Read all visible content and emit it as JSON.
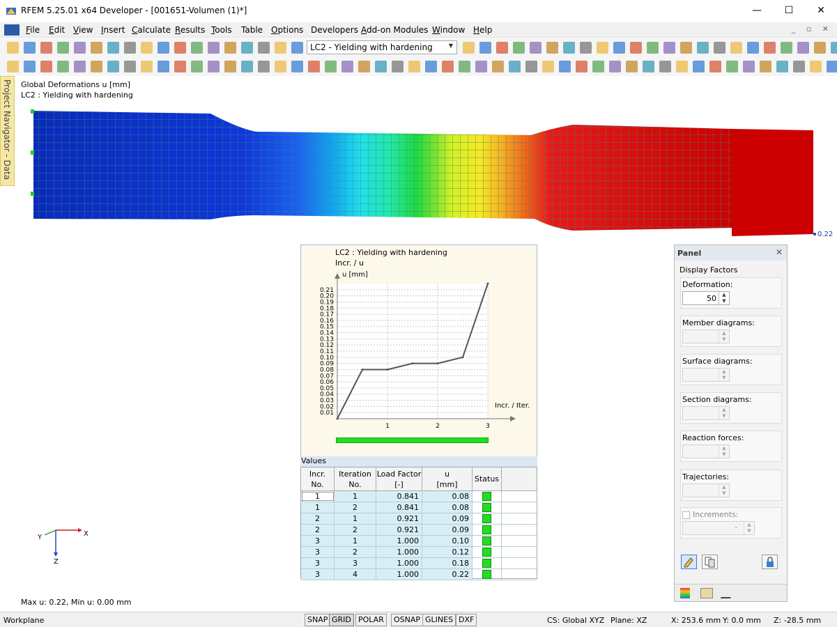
{
  "window": {
    "title": "RFEM 5.25.01 x64 Developer - [001651-Volumen (1)*]",
    "minimize": "—",
    "maximize": "☐",
    "close": "✕"
  },
  "menu": [
    {
      "label": "File",
      "u": "F",
      "rest": "ile"
    },
    {
      "label": "Edit",
      "u": "E",
      "rest": "dit"
    },
    {
      "label": "View",
      "u": "V",
      "rest": "iew"
    },
    {
      "label": "Insert",
      "u": "I",
      "rest": "nsert"
    },
    {
      "label": "Calculate",
      "u": "C",
      "rest": "alculate"
    },
    {
      "label": "Results",
      "u": "R",
      "rest": "esults"
    },
    {
      "label": "Tools",
      "u": "T",
      "rest": "ools"
    },
    {
      "label": "Table",
      "u": "",
      "rest": "Table"
    },
    {
      "label": "Options",
      "u": "O",
      "rest": "ptions"
    },
    {
      "label": "Developers",
      "u": "",
      "rest": "Developers"
    },
    {
      "label": "Add-on Modules",
      "u": "A",
      "rest": "dd-on Modules"
    },
    {
      "label": "Window",
      "u": "W",
      "rest": "indow"
    },
    {
      "label": "Help",
      "u": "H",
      "rest": "elp"
    }
  ],
  "toolbar": {
    "load_case": "LC2 - Yielding with hardening"
  },
  "sidetab": "Project Navigator - Data",
  "viewport": {
    "result_type": "Global Deformations u [mm]",
    "load_case": "LC2 : Yielding with hardening",
    "max_label": "0.22",
    "maxmin": "Max u: 0.22, Min u: 0.00 mm",
    "axis_x": "X",
    "axis_y": "Y",
    "axis_z": "Z"
  },
  "chart": {
    "title": "LC2 : Yielding with hardening",
    "subtitle": "Incr. / u",
    "ylabel": "u [mm]",
    "xlabel": "Incr. / Iter."
  },
  "chart_data": {
    "type": "line",
    "title": "LC2 : Yielding with hardening",
    "xlabel": "Incr. / Iter.",
    "ylabel": "u [mm]",
    "x_ticks": [
      "1",
      "2",
      "3"
    ],
    "y_ticks": [
      "0.01",
      "0.02",
      "0.03",
      "0.04",
      "0.05",
      "0.06",
      "0.07",
      "0.08",
      "0.09",
      "0.10",
      "0.11",
      "0.12",
      "0.13",
      "0.14",
      "0.15",
      "0.16",
      "0.17",
      "0.18",
      "0.19",
      "0.20",
      "0.21"
    ],
    "ylim": [
      0,
      0.22
    ],
    "xlim": [
      0,
      3
    ],
    "x": [
      0,
      0.5,
      1.0,
      1.5,
      2.0,
      2.5,
      3.0
    ],
    "values": [
      0.0,
      0.08,
      0.08,
      0.09,
      0.09,
      0.1,
      0.22
    ],
    "grid": true
  },
  "values_table": {
    "heading": "Values",
    "columns": [
      {
        "l1": "Incr.",
        "l2": "No."
      },
      {
        "l1": "Iteration",
        "l2": "No."
      },
      {
        "l1": "Load Factor",
        "l2": "[-]"
      },
      {
        "l1": "u",
        "l2": "[mm]"
      },
      {
        "l1": "",
        "l2": "Status"
      }
    ],
    "rows": [
      {
        "incr": "1",
        "iter": "1",
        "lf": "0.841",
        "u": "0.08"
      },
      {
        "incr": "1",
        "iter": "2",
        "lf": "0.841",
        "u": "0.08"
      },
      {
        "incr": "2",
        "iter": "1",
        "lf": "0.921",
        "u": "0.09"
      },
      {
        "incr": "2",
        "iter": "2",
        "lf": "0.921",
        "u": "0.09"
      },
      {
        "incr": "3",
        "iter": "1",
        "lf": "1.000",
        "u": "0.10"
      },
      {
        "incr": "3",
        "iter": "2",
        "lf": "1.000",
        "u": "0.12"
      },
      {
        "incr": "3",
        "iter": "3",
        "lf": "1.000",
        "u": "0.18"
      },
      {
        "incr": "3",
        "iter": "4",
        "lf": "1.000",
        "u": "0.22"
      }
    ]
  },
  "panel": {
    "title": "Panel",
    "close": "✕",
    "section": "Display Factors",
    "groups": [
      {
        "label": "Deformation:",
        "value": "50",
        "enabled": true
      },
      {
        "label": "Member diagrams:",
        "value": "",
        "enabled": false
      },
      {
        "label": "Surface diagrams:",
        "value": "",
        "enabled": false
      },
      {
        "label": "Section diagrams:",
        "value": "",
        "enabled": false
      },
      {
        "label": "Reaction forces:",
        "value": "",
        "enabled": false
      },
      {
        "label": "Trajectories:",
        "value": "",
        "enabled": false
      }
    ],
    "increments_label": "Increments:"
  },
  "statusbar": {
    "workplane": "Workplane",
    "buttons": [
      "SNAP",
      "GRID",
      "POLAR",
      "OSNAP",
      "GLINES",
      "DXF"
    ],
    "cs": "CS: Global XYZ",
    "plane": "Plane: XZ",
    "x": "X:  253.6 mm",
    "y": "Y:  0.0 mm",
    "z": "Z:  -28.5 mm"
  },
  "colors": {
    "accent": "#2a5aa8",
    "progress": "#22dd22",
    "max_result": "#cc0000"
  }
}
